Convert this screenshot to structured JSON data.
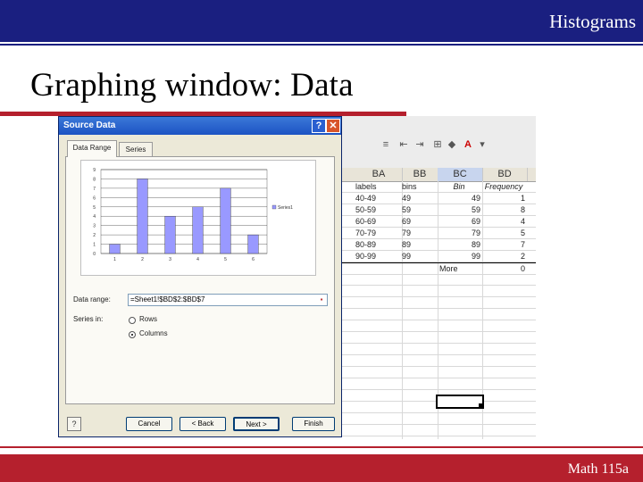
{
  "header": {
    "title": "Histograms"
  },
  "slide": {
    "title": "Graphing window: Data"
  },
  "footer": {
    "text": "Math 115a"
  },
  "dialog": {
    "title": "Source Data",
    "tabs": [
      {
        "label": "Data Range"
      },
      {
        "label": "Series"
      }
    ],
    "data_range_label": "Data range:",
    "data_range_value": "=Sheet1!$BD$2:$BD$7",
    "series_in_label": "Series in:",
    "options": [
      {
        "label": "Rows",
        "selected": false
      },
      {
        "label": "Columns",
        "selected": true
      }
    ],
    "buttons": {
      "cancel": "Cancel",
      "back": "< Back",
      "next": "Next >",
      "finish": "Finish"
    }
  },
  "sheet": {
    "columns": [
      "BA",
      "BB",
      "BC",
      "BD"
    ],
    "header_row": [
      "labels",
      "bins",
      "Bin",
      "Frequency"
    ],
    "rows": [
      {
        "label": "40-49",
        "bins": "49",
        "bin": "49",
        "freq": "1"
      },
      {
        "label": "50-59",
        "bins": "59",
        "bin": "59",
        "freq": "8"
      },
      {
        "label": "60-69",
        "bins": "69",
        "bin": "69",
        "freq": "4"
      },
      {
        "label": "70-79",
        "bins": "79",
        "bin": "79",
        "freq": "5"
      },
      {
        "label": "80-89",
        "bins": "89",
        "bin": "89",
        "freq": "7"
      },
      {
        "label": "90-99",
        "bins": "99",
        "bin": "99",
        "freq": "2"
      },
      {
        "label": "",
        "bins": "",
        "bin": "More",
        "freq": "0"
      }
    ]
  },
  "preview_chart": {
    "type": "bar",
    "categories": [
      "1",
      "2",
      "3",
      "4",
      "5",
      "6"
    ],
    "values": [
      1,
      8,
      4,
      5,
      7,
      2
    ],
    "y_ticks": [
      "0",
      "1",
      "2",
      "3",
      "4",
      "5",
      "6",
      "7",
      "8",
      "9"
    ],
    "ylim": [
      0,
      9
    ],
    "legend": "Series1",
    "bar_color": "#9999ff"
  },
  "colors": {
    "brand_blue": "#1a1f80",
    "brand_red": "#b5202d"
  }
}
